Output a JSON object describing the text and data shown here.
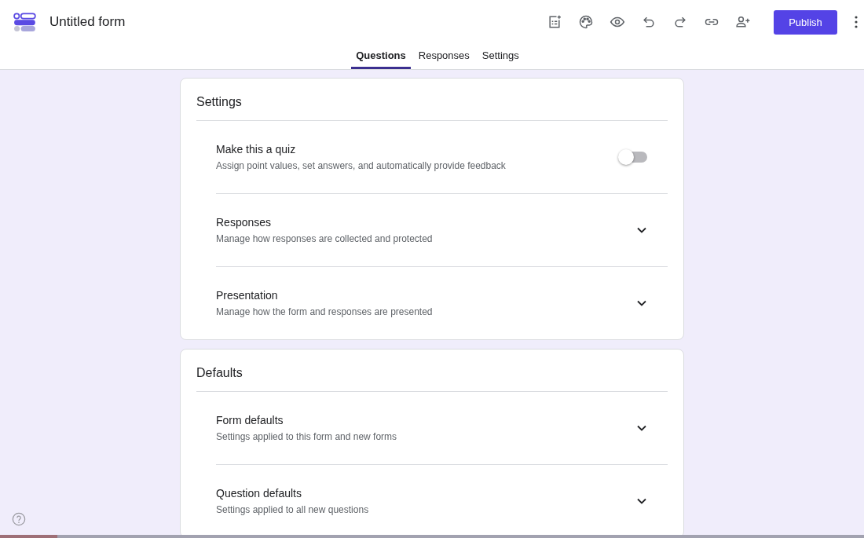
{
  "header": {
    "title": "Untitled form",
    "publish": "Publish"
  },
  "tabs": [
    {
      "label": "Questions",
      "selected": true
    },
    {
      "label": "Responses",
      "selected": false
    },
    {
      "label": "Settings",
      "selected": false
    }
  ],
  "cards": [
    {
      "title": "Settings",
      "rows": [
        {
          "kind": "toggle",
          "title": "Make this a quiz",
          "subtitle": "Assign point values, set answers, and automatically provide feedback",
          "on": false
        },
        {
          "kind": "expand",
          "title": "Responses",
          "subtitle": "Manage how responses are collected and protected"
        },
        {
          "kind": "expand",
          "title": "Presentation",
          "subtitle": "Manage how the form and responses are presented"
        }
      ]
    },
    {
      "title": "Defaults",
      "rows": [
        {
          "kind": "expand",
          "title": "Form defaults",
          "subtitle": "Settings applied to this form and new forms"
        },
        {
          "kind": "expand",
          "title": "Question defaults",
          "subtitle": "Settings applied to all new questions"
        }
      ]
    }
  ],
  "playback_bar": {
    "level": 0.066
  }
}
